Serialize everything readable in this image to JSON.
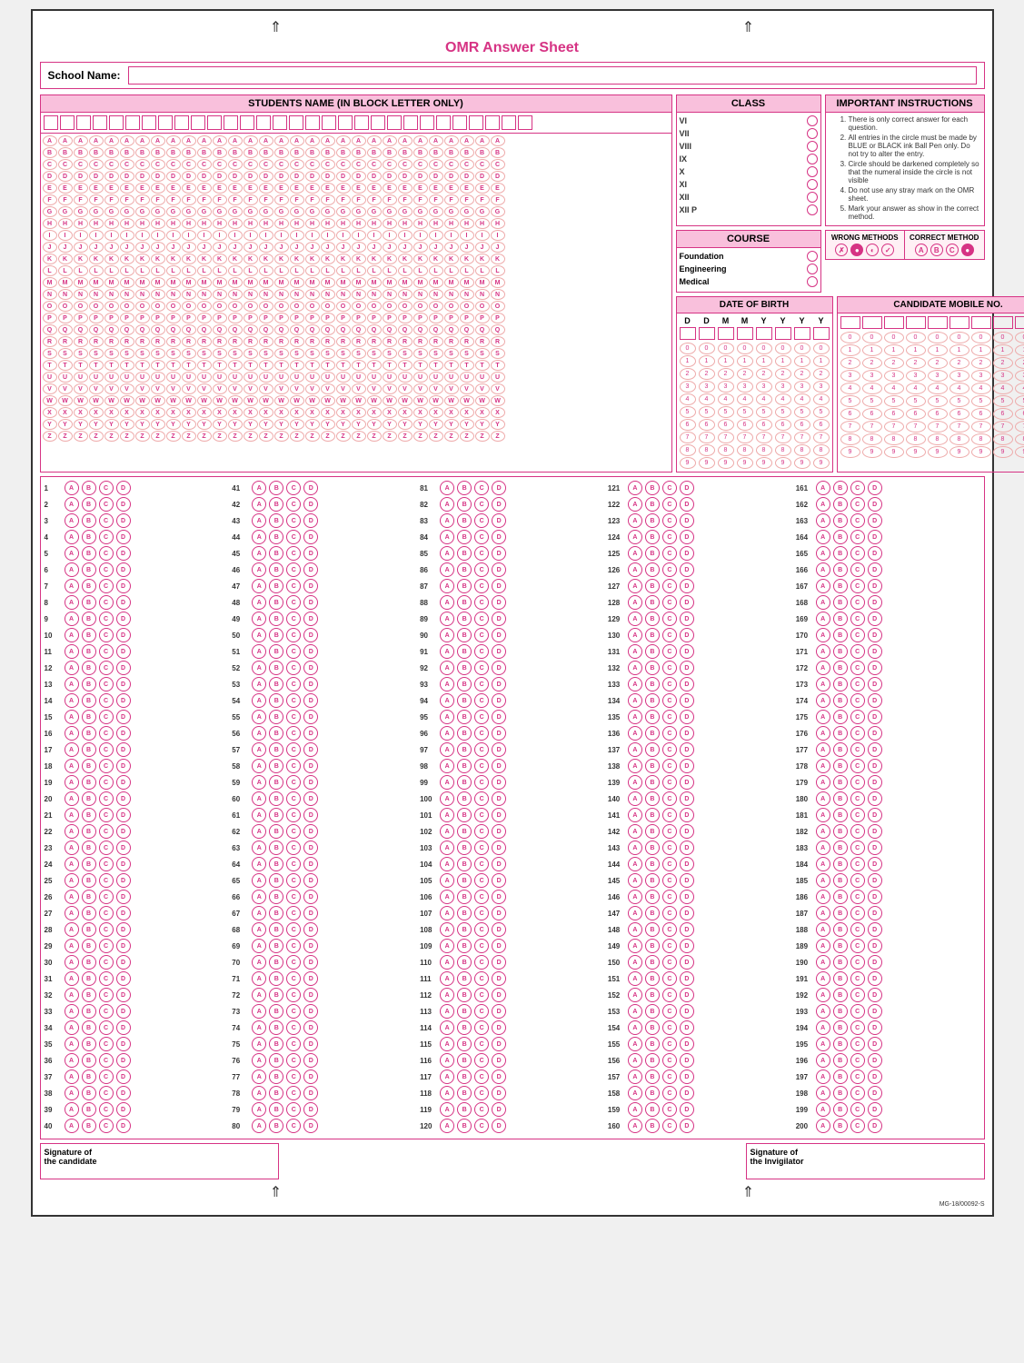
{
  "title": "OMR Answer Sheet",
  "school": {
    "label": "School Name:"
  },
  "students_name": {
    "header": "STUDENTS NAME (IN BLOCK LETTER ONLY)"
  },
  "class_section": {
    "header": "CLASS",
    "items": [
      "VI",
      "VII",
      "VIII",
      "IX",
      "X",
      "XI",
      "XII",
      "XII P"
    ]
  },
  "instructions": {
    "header": "IMPORTANT INSTRUCTIONS",
    "items": [
      "There is only correct answer for each question.",
      "All entries in the circle must be made by BLUE or BLACK ink Ball Pen only. Do not try to alter the entry.",
      "Circle should be darkened completely so that the numeral inside the circle is not visible",
      "Do not use any stray mark on the OMR sheet.",
      "Mark your answer as show in the correct method."
    ]
  },
  "course": {
    "header": "COURSE",
    "items": [
      "Foundation",
      "Engineering",
      "Medical"
    ]
  },
  "wrong_methods": {
    "label": "WRONG METHODS",
    "symbols": [
      "✗",
      "●",
      "◐",
      "✓"
    ]
  },
  "correct_method": {
    "label": "CORRECT METHOD",
    "symbols": [
      "A",
      "B",
      "C",
      "●"
    ]
  },
  "dob": {
    "header": "DATE OF BIRTH",
    "labels": [
      "D",
      "D",
      "M",
      "M",
      "Y",
      "Y",
      "Y",
      "Y"
    ],
    "digits": [
      "0",
      "1",
      "2",
      "3",
      "4",
      "5",
      "6",
      "7",
      "8",
      "9"
    ]
  },
  "mobile": {
    "header": "CANDIDATE MOBILE NO.",
    "digits": [
      "0",
      "1",
      "2",
      "3",
      "4",
      "5",
      "6",
      "7",
      "8",
      "9"
    ]
  },
  "alphabet": "ABCDEFGHIJKLMNOPQRSTUVWXYZ",
  "answer_options": [
    "A",
    "B",
    "C",
    "D"
  ],
  "total_questions": 200,
  "signature_candidate": "Signature of\nthe candidate",
  "signature_invigilator": "Signature of\nthe Invigilator",
  "doc_id": "MG-18/00092-S"
}
